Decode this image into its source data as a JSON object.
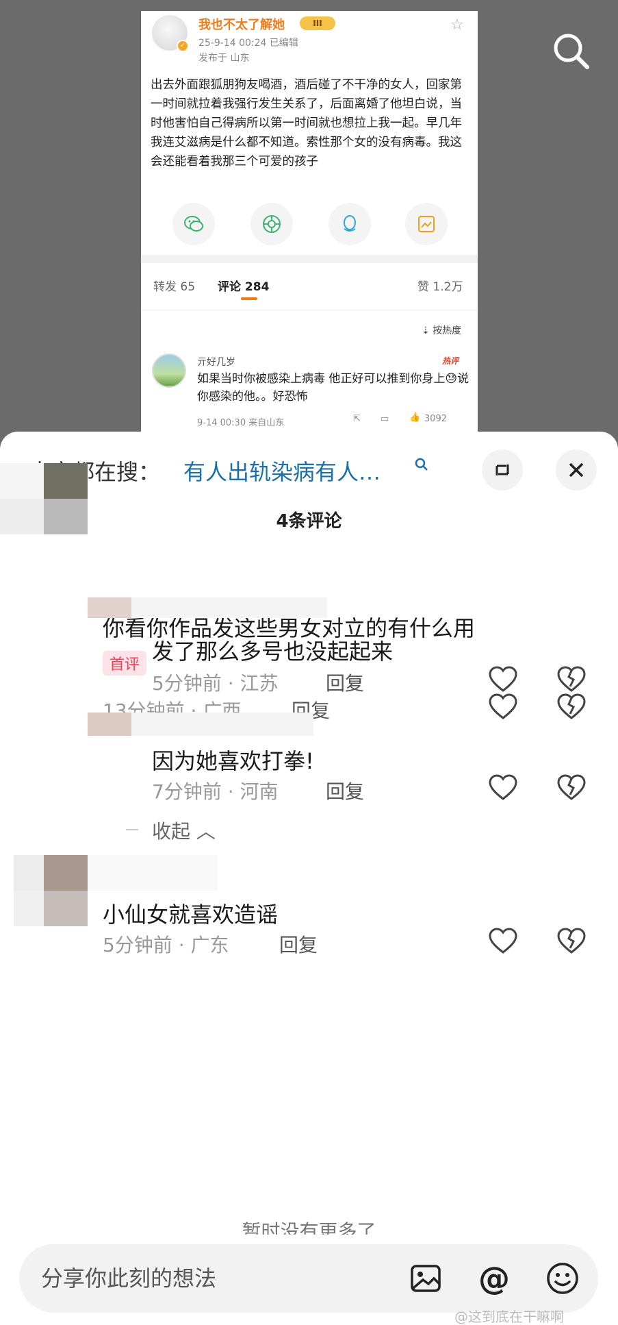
{
  "post": {
    "username": "我也不太了解她",
    "level_badge": "III",
    "meta": "25-9-14 00:24  已编辑",
    "location": "发布于 山东",
    "body": "出去外面跟狐朋狗友喝酒，酒后碰了不干净的女人，回家第一时间就拉着我强行发生关系了，后面离婚了他坦白说，当时他害怕自己得病所以第一时间就也想拉上我一起。早几年我连艾滋病是什么都不知道。索性那个女的没有病毒。我这会还能看着我那三个可爱的孩子",
    "share_icons": [
      "wechat-icon",
      "moments-icon",
      "qq-icon",
      "save-image-icon"
    ],
    "tabs": {
      "repost": "转发 65",
      "comments": "评论 284",
      "likes": "赞 1.2万"
    },
    "sort_label": "按热度",
    "top_comment": {
      "name": "亓好几岁",
      "hot_badge": "热评",
      "text": "如果当时你被感染上病毒 他正好可以推到你身上😓说你感染的他。。好恐怖",
      "meta": "9-14 00:30 来自山东",
      "like_count": "3092"
    }
  },
  "sheet": {
    "trend_label": "大家都在搜：",
    "trend_link": "有人出轨染病有人…",
    "title": "4条评论",
    "comments": [
      {
        "text": "你看你作品发这些男女对立的有什么用",
        "badge": "首评",
        "time": "13分钟前 · 广西",
        "reply": "回复"
      },
      {
        "text": "发了那么多号也没起起来",
        "time": "5分钟前 · 江苏",
        "reply": "回复"
      },
      {
        "text": "因为她喜欢打拳!",
        "time": "7分钟前 · 河南",
        "reply": "回复"
      },
      {
        "text": "小仙女就喜欢造谣",
        "time": "5分钟前 · 广东",
        "reply": "回复"
      }
    ],
    "collapse_label": "收起",
    "no_more": "暂时没有更多了",
    "input_placeholder": "分享你此刻的想法",
    "at_symbol": "@"
  },
  "watermark": "@这到底在干嘛啊",
  "colors": {
    "brand_orange": "#f07b1a",
    "link_blue": "#1c6fa8",
    "badge_pink": "#e8445a",
    "hot_red": "#e8402a"
  }
}
